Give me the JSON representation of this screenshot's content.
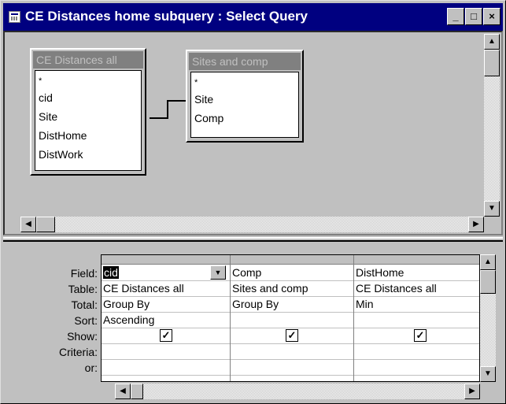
{
  "window": {
    "title": "CE Distances home subquery : Select Query",
    "minimize_glyph": "_",
    "maximize_glyph": "□",
    "close_glyph": "×"
  },
  "tables": [
    {
      "title": "CE Distances all",
      "fields": [
        "*",
        "cid",
        "Site",
        "DistHome",
        "DistWork"
      ]
    },
    {
      "title": "Sites and comp",
      "fields": [
        "*",
        "Site",
        "Comp"
      ]
    }
  ],
  "grid": {
    "row_labels": [
      "Field:",
      "Table:",
      "Total:",
      "Sort:",
      "Show:",
      "Criteria:",
      "or:"
    ],
    "columns": [
      {
        "field": "cid",
        "table": "CE Distances all",
        "total": "Group By",
        "sort": "Ascending",
        "show": true
      },
      {
        "field": "Comp",
        "table": "Sites and comp",
        "total": "Group By",
        "sort": "",
        "show": true
      },
      {
        "field": "DistHome",
        "table": "CE Distances all",
        "total": "Min",
        "sort": "",
        "show": true
      }
    ]
  },
  "icons": {
    "arrow_up": "▲",
    "arrow_down": "▼",
    "arrow_left": "◀",
    "arrow_right": "▶",
    "check": "✓"
  }
}
